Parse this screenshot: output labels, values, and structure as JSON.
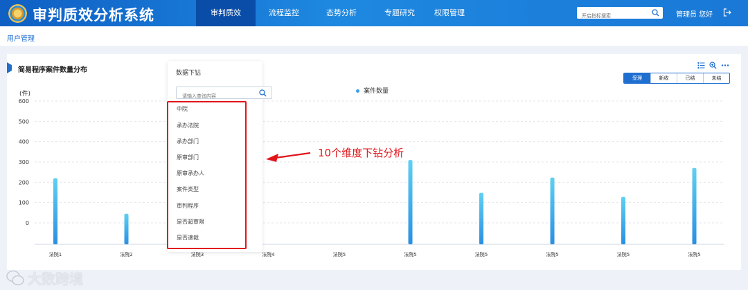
{
  "header": {
    "title": "审判质效分析系统",
    "nav": [
      {
        "label": "审判质效",
        "active": true
      },
      {
        "label": "流程监控",
        "active": false
      },
      {
        "label": "态势分析",
        "active": false
      },
      {
        "label": "专题研究",
        "active": false
      },
      {
        "label": "权限管理",
        "active": false
      }
    ],
    "search_placeholder": "开启指标搜索",
    "user_text": "管理员 您好",
    "accent": "#1a78d6"
  },
  "breadcrumb": "用户管理",
  "section": {
    "title": "简易程序案件数量分布",
    "tabs": [
      {
        "label": "受理",
        "active": true
      },
      {
        "label": "新收",
        "active": false
      },
      {
        "label": "已结",
        "active": false
      },
      {
        "label": "未结",
        "active": false
      }
    ]
  },
  "drilldown": {
    "title": "数据下钻",
    "search_placeholder": "请输入查询内容",
    "items": [
      "中院",
      "承办法院",
      "承办部门",
      "原审部门",
      "原审承办人",
      "案件类型",
      "审判程序",
      "是否超审限",
      "是否速裁"
    ],
    "highlight_color": "#e0151a"
  },
  "annotation": "10个维度下钻分析",
  "watermark": "大数跨境",
  "chart_data": {
    "type": "bar",
    "ylabel": "(件)",
    "legend": [
      "案件数量"
    ],
    "legend_position": "top-center",
    "yticks": [
      600,
      500,
      400,
      300,
      200,
      100,
      0
    ],
    "ylim": [
      0,
      600
    ],
    "categories": [
      "法院1",
      "法院2",
      "法院3",
      "法院4",
      "法院5",
      "法院5",
      "法院5",
      "法院5",
      "法院5",
      "法院5"
    ],
    "series": [
      {
        "name": "案件数量",
        "values": [
          220,
          45,
          null,
          null,
          null,
          310,
          148,
          223,
          128,
          270
        ]
      }
    ],
    "grid": true,
    "bar_color": "#3aa0e8"
  }
}
